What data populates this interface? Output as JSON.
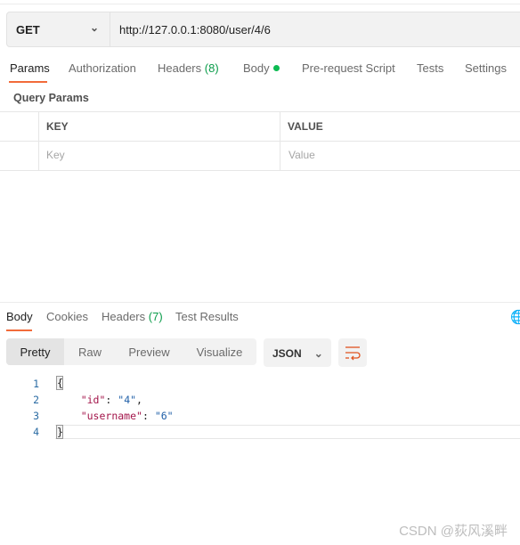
{
  "request": {
    "method": "GET",
    "url": "http://127.0.0.1:8080/user/4/6"
  },
  "request_tabs": [
    {
      "label": "Params",
      "active": true
    },
    {
      "label": "Authorization"
    },
    {
      "label": "Headers",
      "count": "(8)"
    },
    {
      "label": "Body",
      "indicator": "green-dot"
    },
    {
      "label": "Pre-request Script"
    },
    {
      "label": "Tests"
    },
    {
      "label": "Settings"
    }
  ],
  "query_params": {
    "title": "Query Params",
    "headers": [
      "KEY",
      "VALUE"
    ],
    "placeholders": {
      "key": "Key",
      "value": "Value"
    }
  },
  "response_tabs": [
    {
      "label": "Body",
      "active": true
    },
    {
      "label": "Cookies"
    },
    {
      "label": "Headers",
      "count": "(7)"
    },
    {
      "label": "Test Results"
    }
  ],
  "view_modes": [
    "Pretty",
    "Raw",
    "Preview",
    "Visualize"
  ],
  "selected_view": "Pretty",
  "format": "JSON",
  "code_lines": [
    {
      "n": "1",
      "text": "{"
    },
    {
      "n": "2",
      "key": "\"id\"",
      "sep": ": ",
      "val": "\"4\"",
      "tail": ","
    },
    {
      "n": "3",
      "key": "\"username\"",
      "sep": ": ",
      "val": "\"6\"",
      "tail": ""
    },
    {
      "n": "4",
      "text": "}"
    }
  ],
  "watermark": "CSDN @荻风溪畔",
  "colors": {
    "accent": "#f26b3a",
    "success": "#0cbb52"
  }
}
